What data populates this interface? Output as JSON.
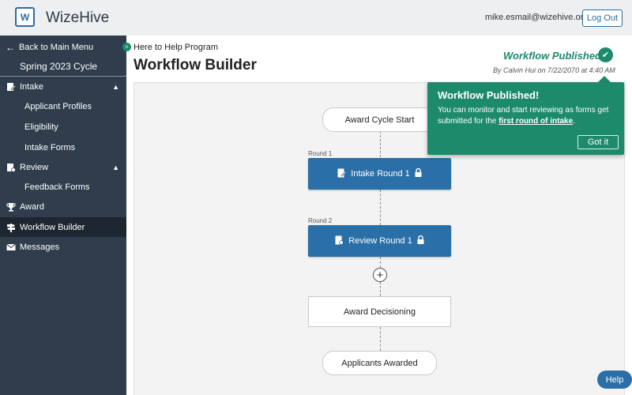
{
  "header": {
    "logo_letter": "W",
    "brand": "WizeHive",
    "user_email": "mike.esmail@wizehive.org",
    "logout_label": "Log Out"
  },
  "sidebar": {
    "back_label": "Back to Main Menu",
    "cycle_label": "Spring 2023 Cycle",
    "intake": {
      "label": "Intake",
      "items": [
        "Applicant Profiles",
        "Eligibility",
        "Intake Forms"
      ]
    },
    "review": {
      "label": "Review",
      "items": [
        "Feedback Forms"
      ]
    },
    "award_label": "Award",
    "workflow_label": "Workflow Builder",
    "messages_label": "Messages"
  },
  "main": {
    "breadcrumb": "Here to Help Program",
    "title": "Workflow Builder",
    "status_text": "Workflow Published",
    "status_by": "By Calvin Hui on 7/22/2070 at 4:40 AM"
  },
  "workflow": {
    "start": "Award Cycle Start",
    "round1_label": "Round 1",
    "round1_step": "Intake Round 1",
    "round2_label": "Round 2",
    "round2_step": "Review Round 1",
    "decision": "Award Decisioning",
    "end": "Applicants Awarded"
  },
  "toast": {
    "title": "Workflow Published!",
    "body_prefix": "You can monitor and start reviewing as forms get submitted for the ",
    "body_link": "first round of intake",
    "body_suffix": ".",
    "button": "Got it"
  },
  "help_label": "Help",
  "colors": {
    "brand_blue": "#2c6da1",
    "success_green": "#1d8a6c",
    "sidebar_bg": "#2f3d4c"
  }
}
